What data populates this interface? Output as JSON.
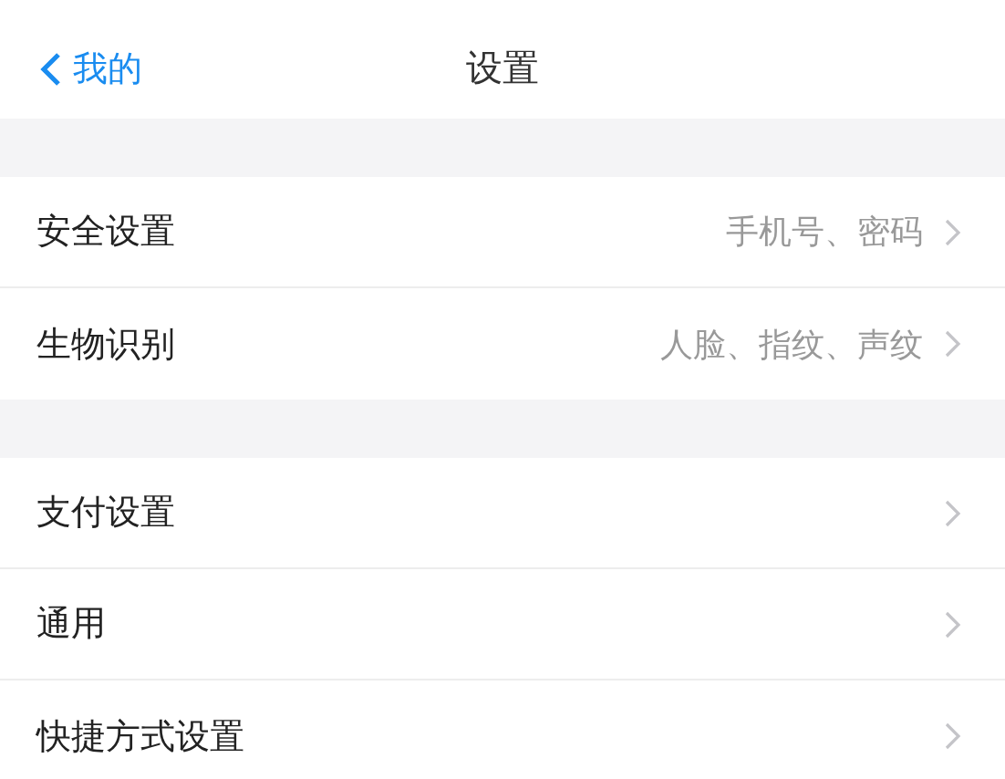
{
  "nav": {
    "back": "我的",
    "title": "设置"
  },
  "groups": [
    {
      "items": [
        {
          "label": "安全设置",
          "detail": "手机号、密码"
        },
        {
          "label": "生物识别",
          "detail": "人脸、指纹、声纹"
        }
      ]
    },
    {
      "items": [
        {
          "label": "支付设置"
        },
        {
          "label": "通用"
        },
        {
          "label": "快捷方式设置"
        }
      ]
    }
  ]
}
